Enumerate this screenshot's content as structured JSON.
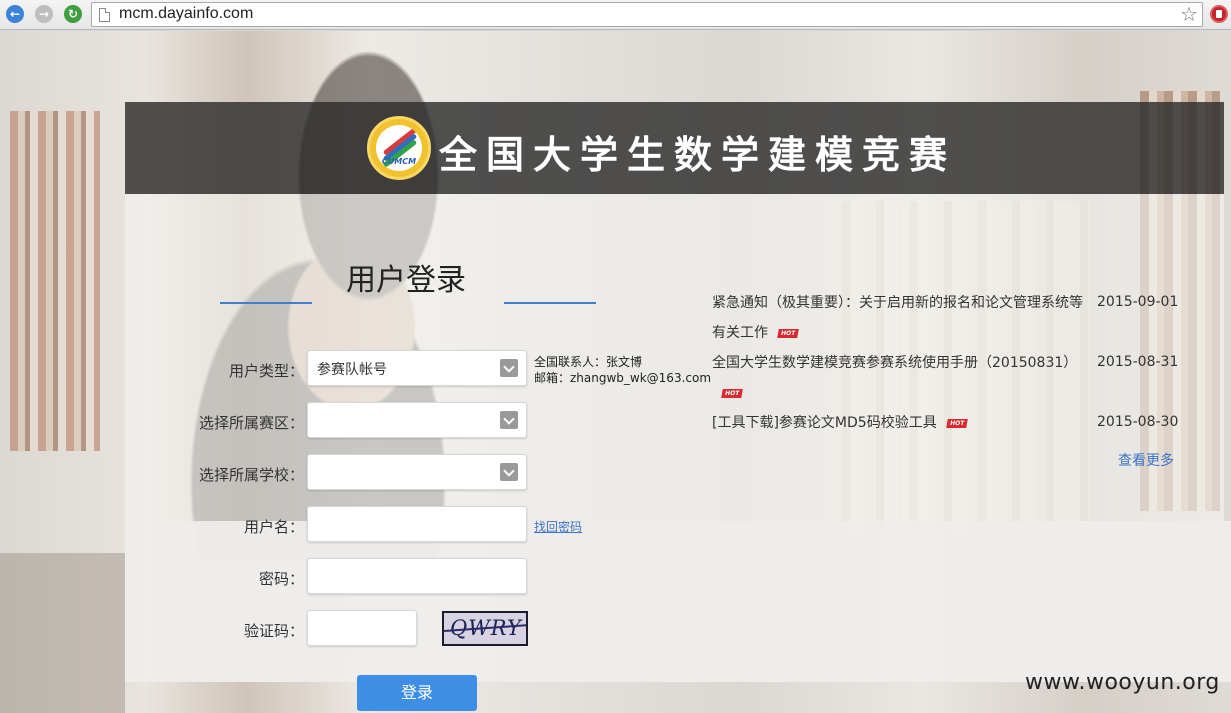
{
  "browser": {
    "url": "mcm.dayainfo.com"
  },
  "header": {
    "logo_text": "CUMCM",
    "title": "全国大学生数学建模竞赛"
  },
  "login": {
    "title": "用户登录",
    "fields": {
      "user_type_label": "用户类型：",
      "user_type_value": "参赛队帐号",
      "region_label": "选择所属赛区：",
      "region_value": "",
      "school_label": "选择所属学校：",
      "school_value": "",
      "username_label": "用户名：",
      "username_value": "",
      "password_label": "密码：",
      "password_value": "",
      "captcha_label": "验证码：",
      "captcha_value": ""
    },
    "captcha_image_text": "QWRY",
    "forgot_password": "找回密码",
    "submit": "登录",
    "contact_line1": "全国联系人：张文博",
    "contact_line2": "邮箱：zhangwb_wk@163.com"
  },
  "news": {
    "items": [
      {
        "title": "紧急通知（极其重要）：关于启用新的报名和论文管理系统等有关工作",
        "date": "2015-09-01",
        "hot": "HOT"
      },
      {
        "title": "全国大学生数学建模竞赛参赛系统使用手册（20150831）",
        "date": "2015-08-31",
        "hot": "HOT"
      },
      {
        "title": "[工具下载]参赛论文MD5码校验工具",
        "date": "2015-08-30",
        "hot": "HOT"
      }
    ],
    "more": "查看更多"
  },
  "watermark": "www.wooyun.org"
}
